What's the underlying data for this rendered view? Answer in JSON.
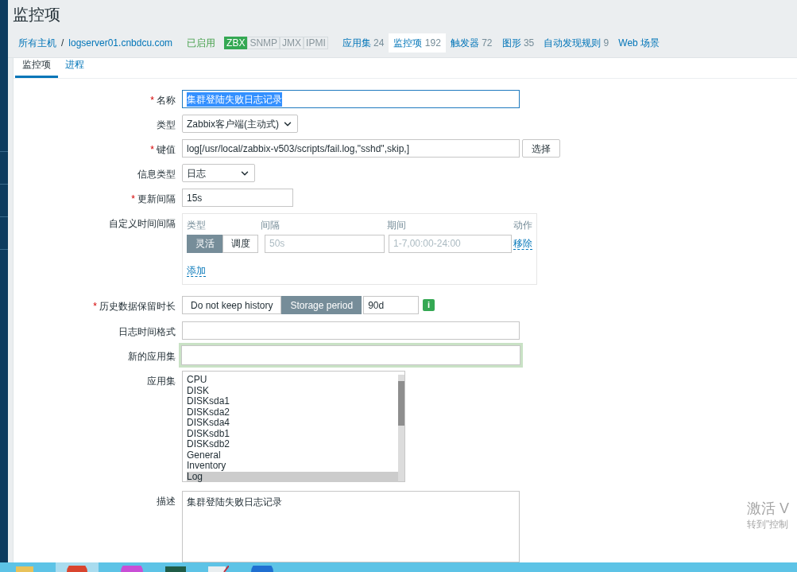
{
  "page_title": "监控项",
  "breadcrumb": [
    {
      "label": "所有主机"
    },
    {
      "label": "logserver01.cnbdcu.com"
    }
  ],
  "breadcrumb_separator": "/",
  "status": "已启用",
  "interfaces": [
    {
      "label": "ZBX",
      "active": true
    },
    {
      "label": "SNMP",
      "active": false
    },
    {
      "label": "JMX",
      "active": false
    },
    {
      "label": "IPMI",
      "active": false
    }
  ],
  "host_tabs": [
    {
      "label": "应用集",
      "count": "24",
      "selected": false
    },
    {
      "label": "监控项",
      "count": "192",
      "selected": true
    },
    {
      "label": "触发器",
      "count": "72",
      "selected": false
    },
    {
      "label": "图形",
      "count": "35",
      "selected": false
    },
    {
      "label": "自动发现规则",
      "count": "9",
      "selected": false
    },
    {
      "label": "Web 场景",
      "selected": false
    }
  ],
  "subtabs": [
    {
      "label": "监控项",
      "selected": true
    },
    {
      "label": "进程",
      "selected": false
    }
  ],
  "form": [
    {
      "kind": "text",
      "required_mark": "*",
      "label": "名称",
      "value": "集群登陆失败日志记录",
      "text_selected": true,
      "focused": false
    },
    {
      "kind": "select",
      "label": "类型",
      "value": "Zabbix客户端(主动式)"
    },
    {
      "kind": "key",
      "required_mark": "*",
      "label": "键值",
      "value": "log[/usr/local/zabbix-v503/scripts/fail.log,\"sshd\",skip,]",
      "button": "选择"
    },
    {
      "kind": "select",
      "label": "信息类型",
      "value": "日志"
    },
    {
      "kind": "short_text",
      "required_mark": "*",
      "label": "更新间隔",
      "value": "15s"
    },
    {
      "kind": "intervals",
      "label": "自定义时间间隔",
      "columns": [
        "类型",
        "间隔",
        "期间",
        "动作"
      ],
      "rows": [
        {
          "modes": [
            {
              "label": "灵活",
              "selected": true
            },
            {
              "label": "调度",
              "selected": false
            }
          ],
          "interval_placeholder": "50s",
          "period_placeholder": "1-7,00:00-24:00",
          "action": "移除"
        }
      ],
      "add": "添加"
    },
    {
      "kind": "history",
      "required_mark": "*",
      "label": "历史数据保留时长",
      "modes": [
        {
          "label": "Do not keep history",
          "selected": false
        },
        {
          "label": "Storage period",
          "selected": true
        }
      ],
      "value": "90d",
      "info": "i"
    },
    {
      "kind": "text",
      "label": "日志时间格式",
      "focused": false
    },
    {
      "kind": "text",
      "label": "新的应用集",
      "focused": true
    },
    {
      "kind": "listbox",
      "label": "应用集",
      "items": [
        {
          "label": "CPU",
          "selected": false
        },
        {
          "label": "DISK",
          "selected": false
        },
        {
          "label": "DISKsda1",
          "selected": false
        },
        {
          "label": "DISKsda2",
          "selected": false
        },
        {
          "label": "DISKsda4",
          "selected": false
        },
        {
          "label": "DISKsdb1",
          "selected": false
        },
        {
          "label": "DISKsdb2",
          "selected": false
        },
        {
          "label": "General",
          "selected": false
        },
        {
          "label": "Inventory",
          "selected": false
        },
        {
          "label": "Log",
          "selected": true
        }
      ]
    },
    {
      "kind": "textarea",
      "label": "描述",
      "value": "集群登陆失败日志记录"
    }
  ],
  "activation_notice": {
    "title": "激活 V",
    "subtitle": "转到\"控制"
  }
}
